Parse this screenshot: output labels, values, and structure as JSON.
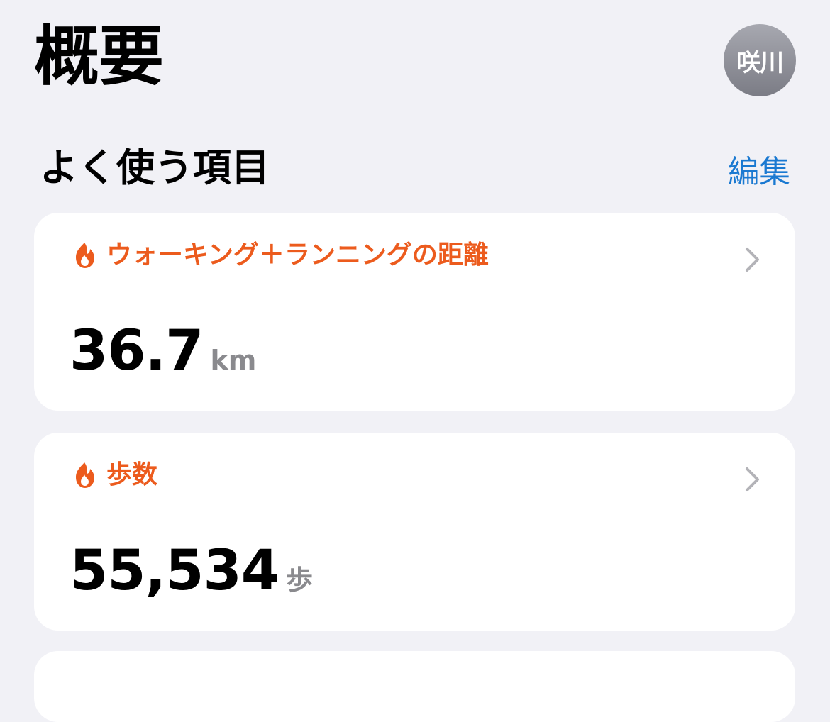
{
  "header": {
    "title": "概要",
    "avatar_text": "咲川"
  },
  "favorites": {
    "title": "よく使う項目",
    "edit_label": "編集"
  },
  "cards": [
    {
      "title": "ウォーキング＋ランニングの距離",
      "value": "36.7",
      "unit": "km",
      "icon": "flame-icon"
    },
    {
      "title": "歩数",
      "value": "55,534",
      "unit": "歩",
      "icon": "flame-icon"
    }
  ],
  "colors": {
    "background": "#f1f1f6",
    "accent_orange": "#ec5b1d",
    "link_blue": "#1a79d1",
    "unit_gray": "#8a8a8e"
  }
}
